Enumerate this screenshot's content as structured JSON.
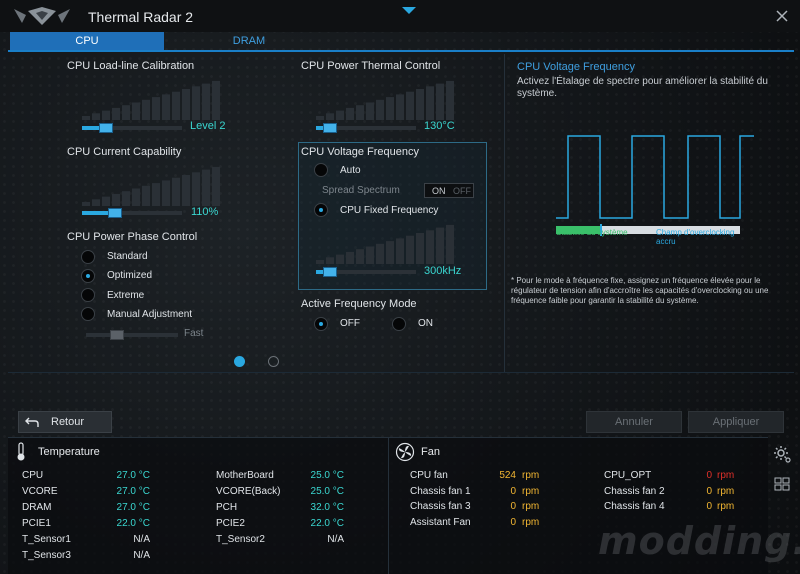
{
  "app": {
    "title": "Thermal Radar 2"
  },
  "tabs": [
    {
      "label": "CPU"
    },
    {
      "label": "DRAM"
    }
  ],
  "llc": {
    "label": "CPU Load-line Calibration",
    "value": "Level 2",
    "fraction": 0.2
  },
  "current": {
    "label": "CPU Current Capability",
    "value": "110%",
    "fraction": 0.3
  },
  "phase": {
    "label": "CPU Power Phase Control",
    "options": [
      {
        "label": "Standard",
        "selected": false
      },
      {
        "label": "Optimized",
        "selected": true
      },
      {
        "label": "Extreme",
        "selected": false
      },
      {
        "label": "Manual Adjustment",
        "selected": false
      }
    ],
    "speed_label": "Fast"
  },
  "thermal": {
    "label": "CPU Power Thermal Control",
    "value": "130°C",
    "fraction": 0.08
  },
  "vf": {
    "label": "CPU Voltage Frequency",
    "auto_label": "Auto",
    "spread_label": "Spread Spectrum",
    "toggle_on": "ON",
    "toggle_off": "OFF",
    "fixed_label": "CPU Fixed Frequency",
    "value": "300kHz",
    "fraction": 0.08
  },
  "afm": {
    "label": "Active Frequency Mode",
    "off_label": "OFF",
    "on_label": "ON"
  },
  "help": {
    "title": "CPU Voltage Frequency",
    "description": "Activez l'Étalage de spectre pour améliorer la stabilité du système.",
    "stability_label": "Stabilité du système",
    "oc_label": "Champ d'overclocking accru",
    "note": "* Pour le mode à fréquence fixe, assignez un fréquence élevée pour le régulateur de tension afin d'accroître les capacités d'overclocking ou une fréquence faible pour garantir la stabilité du système."
  },
  "buttons": {
    "back": "Retour",
    "undo": "Annuler",
    "apply": "Appliquer"
  },
  "temperature": {
    "title": "Temperature",
    "left": [
      {
        "name": "CPU",
        "value": "27.0 °C"
      },
      {
        "name": "VCORE",
        "value": "27.0 °C"
      },
      {
        "name": "DRAM",
        "value": "27.0 °C"
      },
      {
        "name": "PCIE1",
        "value": "22.0 °C"
      },
      {
        "name": "T_Sensor1",
        "value": "N/A"
      },
      {
        "name": "T_Sensor3",
        "value": "N/A"
      }
    ],
    "right": [
      {
        "name": "MotherBoard",
        "value": "25.0 °C"
      },
      {
        "name": "VCORE(Back)",
        "value": "25.0 °C"
      },
      {
        "name": "PCH",
        "value": "32.0 °C"
      },
      {
        "name": "PCIE2",
        "value": "22.0 °C"
      },
      {
        "name": "T_Sensor2",
        "value": "N/A"
      }
    ]
  },
  "fan": {
    "title": "Fan",
    "left": [
      {
        "name": "CPU fan",
        "value": "524",
        "unit": "rpm"
      },
      {
        "name": "Chassis fan 1",
        "value": "0",
        "unit": "rpm"
      },
      {
        "name": "Chassis fan 3",
        "value": "0",
        "unit": "rpm"
      },
      {
        "name": "Assistant Fan",
        "value": "0",
        "unit": "rpm"
      }
    ],
    "right": [
      {
        "name": "CPU_OPT",
        "value": "0",
        "unit": "rpm"
      },
      {
        "name": "Chassis fan 2",
        "value": "0",
        "unit": "rpm"
      },
      {
        "name": "Chassis fan 4",
        "value": "0",
        "unit": "rpm"
      }
    ]
  },
  "watermark": "modding.fr",
  "colors": {
    "accent": "#2aa8e0",
    "value": "#3ad6d0",
    "fan_value": "#f2b632",
    "alert": "#e0302a"
  }
}
